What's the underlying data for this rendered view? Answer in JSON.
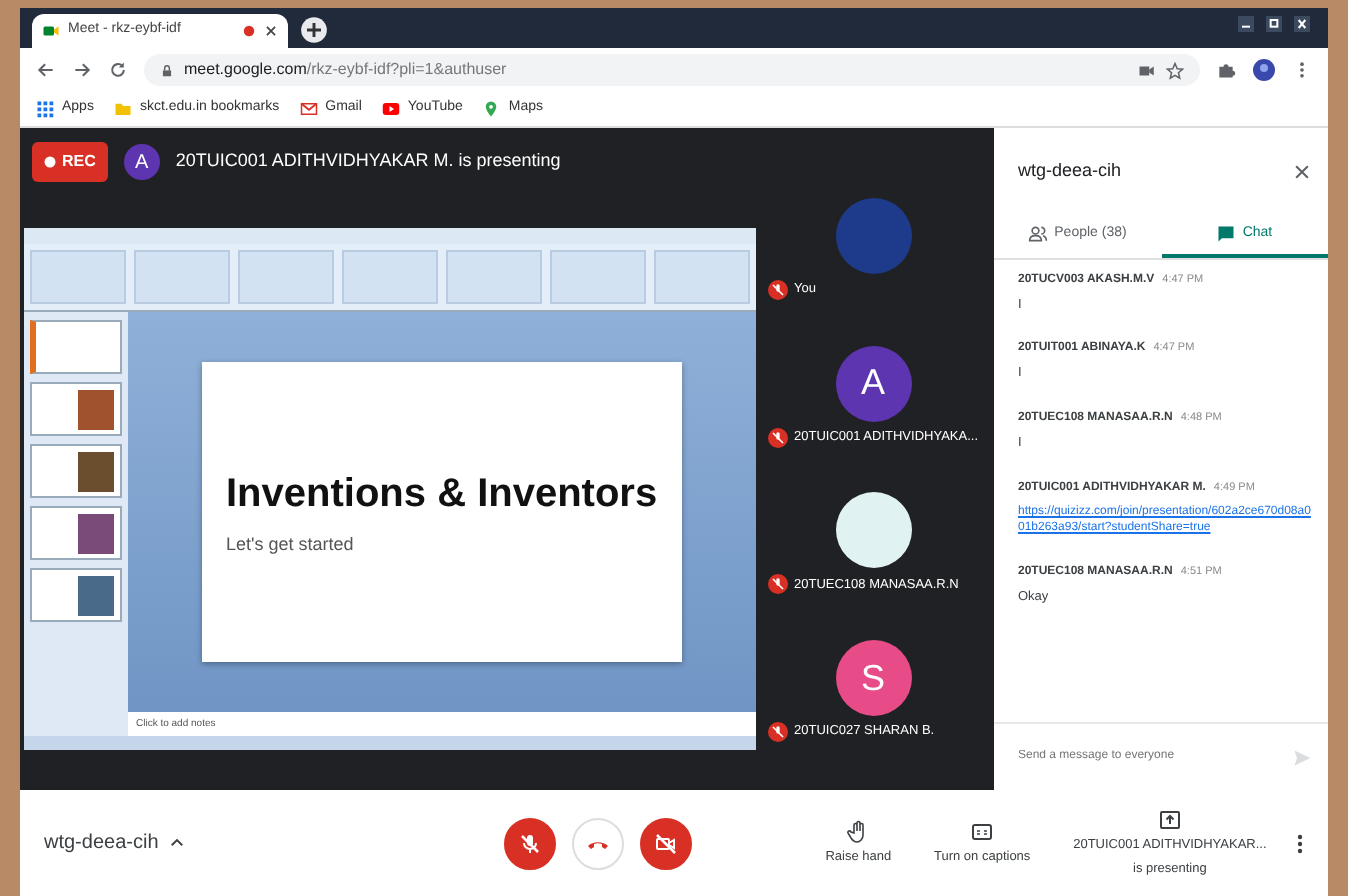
{
  "browser": {
    "tab_title": "Meet - rkz-eybf-idf",
    "recording": true,
    "url_host": "meet.google.com",
    "url_path": "/rkz-eybf-idf?pli=1&authuser",
    "bookmarks": [
      {
        "kind": "apps",
        "label": "Apps"
      },
      {
        "kind": "folder",
        "label": "skct.edu.in bookmarks"
      },
      {
        "kind": "gmail",
        "label": "Gmail"
      },
      {
        "kind": "youtube",
        "label": "YouTube"
      },
      {
        "kind": "maps",
        "label": "Maps"
      }
    ]
  },
  "meeting_header": {
    "rec_label": "REC",
    "presenter": {
      "initial": "A",
      "color": "#5e35b1"
    },
    "presenting_text": "20TUIC001 ADITHVIDHYAKAR M. is presenting"
  },
  "presentation": {
    "slide_title": "Inventions & Inventors",
    "slide_subtitle": "Let's get started",
    "notes_placeholder": "Click to add notes"
  },
  "participants": [
    {
      "name": "You",
      "kind": "image",
      "muted": true
    },
    {
      "name": "20TUIC001 ADITHVIDHYAKA...",
      "kind": "initial",
      "initial": "A",
      "color": "#5e35b1",
      "muted": true
    },
    {
      "name": "20TUEC108 MANASAA.R.N",
      "kind": "image",
      "muted": true
    },
    {
      "name": "20TUIC027 SHARAN B.",
      "kind": "initial",
      "initial": "S",
      "color": "#e84c88",
      "muted": true
    }
  ],
  "chat_panel": {
    "title": "wtg-deea-cih",
    "tabs": [
      {
        "kind": "people",
        "label": "People (38)",
        "selected": false
      },
      {
        "kind": "chat",
        "label": "Chat",
        "selected": true
      }
    ],
    "messages": [
      {
        "sender": "20TUCV003 AKASH.M.V",
        "time": "4:47 PM",
        "text": "I"
      },
      {
        "sender": "20TUIT001 ABINAYA.K",
        "time": "4:47 PM",
        "text": "I"
      },
      {
        "sender": "20TUEC108 MANASAA.R.N",
        "time": "4:48 PM",
        "text": "I"
      },
      {
        "sender": "20TUIC001 ADITHVIDHYAKAR M.",
        "time": "4:49 PM",
        "link": "https://quizizz.com/join/presentation/602a2ce670d08a001b263a93/start?studentShare=true"
      },
      {
        "sender": "20TUEC108 MANASAA.R.N",
        "time": "4:51 PM",
        "text": "Okay"
      }
    ],
    "input_placeholder": "Send a message to everyone"
  },
  "bottom_bar": {
    "meeting_code": "wtg-deea-cih",
    "controls": [
      {
        "kind": "mic",
        "off": true
      },
      {
        "kind": "hangup",
        "off": false
      },
      {
        "kind": "camera",
        "off": true
      }
    ],
    "actions": [
      {
        "kind": "hand",
        "label": "Raise hand"
      },
      {
        "kind": "captions",
        "label": "Turn on captions"
      },
      {
        "kind": "present",
        "label": "20TUIC001 ADITHVIDHYAKAR...",
        "sublabel": "is presenting"
      }
    ]
  }
}
